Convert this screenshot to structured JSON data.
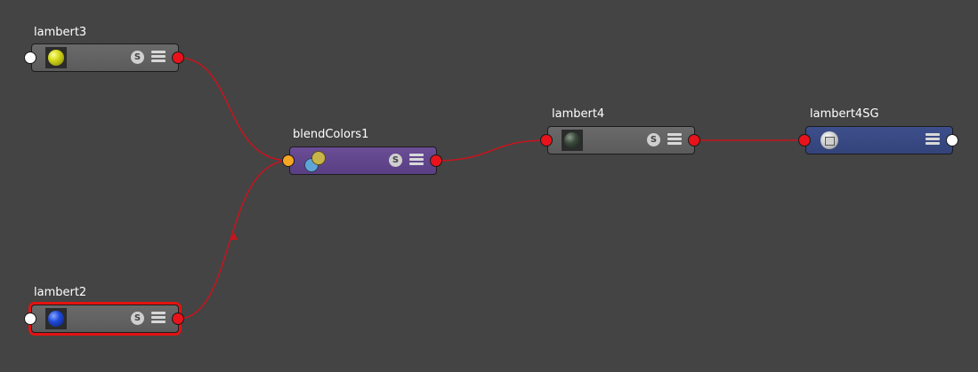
{
  "graph": {
    "nodes": {
      "lambert3": {
        "title": "lambert3",
        "badge": "S",
        "thumb": "yellow-sphere-swatch"
      },
      "lambert2": {
        "title": "lambert2",
        "badge": "S",
        "thumb": "blue-sphere-swatch",
        "selected": true
      },
      "blendColors1": {
        "title": "blendColors1",
        "badge": "S",
        "thumb": "blend-colors-icon"
      },
      "lambert4": {
        "title": "lambert4",
        "badge": "S",
        "thumb": "dark-sphere-swatch"
      },
      "lambert4SG": {
        "title": "lambert4SG",
        "thumb": "shading-group-icon"
      }
    },
    "connections": [
      {
        "from": "lambert3",
        "to": "blendColors1"
      },
      {
        "from": "lambert2",
        "to": "blendColors1"
      },
      {
        "from": "blendColors1",
        "to": "lambert4"
      },
      {
        "from": "lambert4",
        "to": "lambert4SG"
      }
    ],
    "colors": {
      "background": "#444444",
      "wire": "#c8141c",
      "node_grey": "#5f5f5f",
      "node_purple": "#5f4488",
      "node_blue": "#374883",
      "port_output": "#e8131b",
      "port_input": "#ffffff",
      "port_blend_input": "#f5a623",
      "selection": "#e41212"
    }
  }
}
